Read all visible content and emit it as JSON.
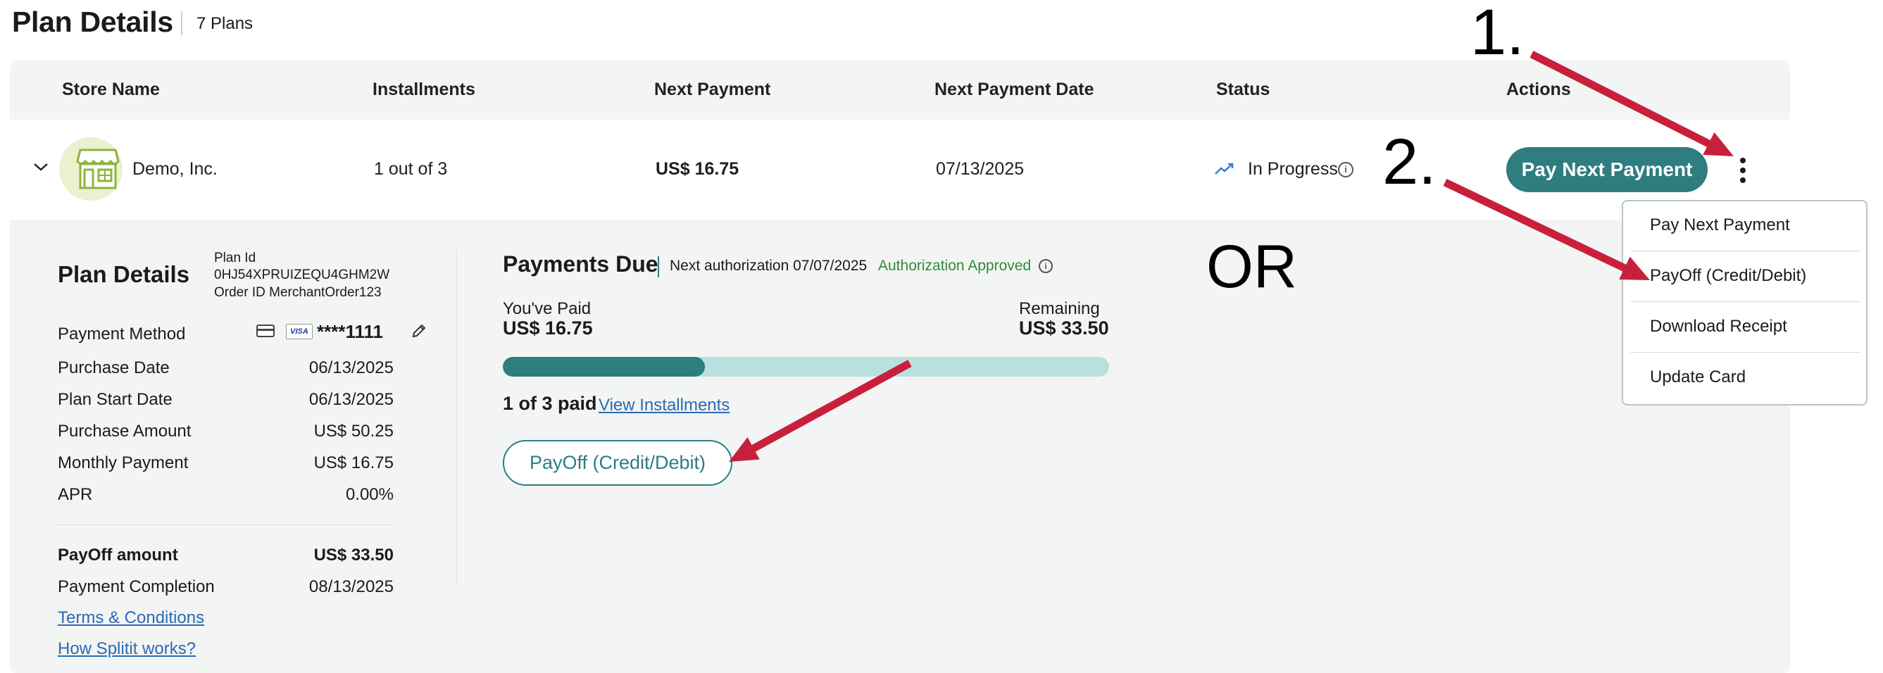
{
  "header": {
    "title": "Plan Details",
    "plan_count": "7 Plans"
  },
  "table": {
    "columns": [
      "Store Name",
      "Installments",
      "Next Payment",
      "Next Payment Date",
      "Status",
      "Actions"
    ],
    "row": {
      "store_name": "Demo, Inc.",
      "installments": "1 out of 3",
      "next_payment": "US$ 16.75",
      "next_payment_date": "07/13/2025",
      "status": "In Progress",
      "action_button": "Pay Next Payment"
    }
  },
  "actions_menu": {
    "items": [
      "Pay Next Payment",
      "PayOff (Credit/Debit)",
      "Download Receipt",
      "Update Card"
    ]
  },
  "plan_details": {
    "title": "Plan Details",
    "plan_id_label": "Plan Id",
    "plan_id": "0HJ54XPRUIZEQU4GHM2W",
    "order_id": "Order ID MerchantOrder123",
    "payment_method_label": "Payment Method",
    "card_number": "****1111",
    "rows": [
      {
        "label": "Purchase Date",
        "value": "06/13/2025"
      },
      {
        "label": "Plan Start Date",
        "value": "06/13/2025"
      },
      {
        "label": "Purchase Amount",
        "value": "US$ 50.25"
      },
      {
        "label": "Monthly Payment",
        "value": "US$ 16.75"
      },
      {
        "label": "APR",
        "value": "0.00%"
      }
    ],
    "payoff_label": "PayOff amount",
    "payoff_value": "US$ 33.50",
    "completion_label": "Payment Completion",
    "completion_value": "08/13/2025",
    "links": [
      "Terms & Conditions",
      "How Splitit works?"
    ]
  },
  "payments_due": {
    "title": "Payments Due",
    "next_authorization": "Next authorization 07/07/2025",
    "authorization_status": "Authorization Approved",
    "paid_label": "You've Paid",
    "paid_value": "US$ 16.75",
    "remaining_label": "Remaining",
    "remaining_value": "US$ 33.50",
    "progress_fraction": 0.333,
    "paid_count": "1 of 3 paid",
    "view_installments": "View Installments",
    "payoff_button": "PayOff (Credit/Debit)"
  },
  "annotations": {
    "step1": "1.",
    "step2": "2.",
    "or": "OR",
    "arrow_color": "#c8203c"
  },
  "colors": {
    "accent": "#2e7d7f",
    "link": "#2a6bb0",
    "approved": "#2e8b3a",
    "progress_track": "#b9dfdf"
  },
  "icons": [
    "chevron-down-icon",
    "store-icon",
    "trend-up-icon",
    "info-icon",
    "credit-card-icon",
    "visa-icon",
    "edit-pencil-icon",
    "kebab-menu-icon"
  ]
}
